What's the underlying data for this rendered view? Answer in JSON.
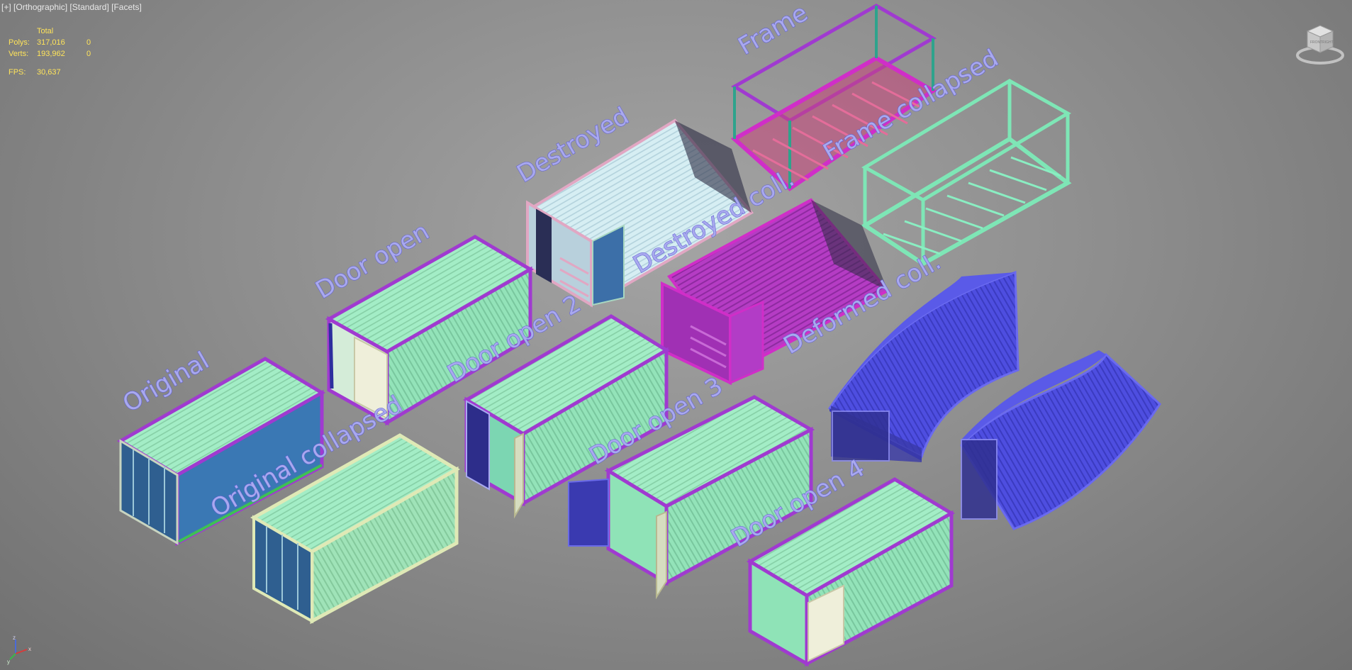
{
  "viewport": {
    "menu_plus": "[+]",
    "view_mode": "[Orthographic]",
    "shading_style": "[Standard]",
    "display_mode": "[Facets]"
  },
  "stats": {
    "header": "Total",
    "polys_label": "Polys:",
    "polys_total": "317,016",
    "polys_selected": "0",
    "verts_label": "Verts:",
    "verts_total": "193,962",
    "verts_selected": "0",
    "fps_label": "FPS:",
    "fps_value": "30,637"
  },
  "viewcube": {
    "icon": "viewcube-icon",
    "face_left": "FRONT",
    "face_right": "RIGHT"
  },
  "axis_gizmo": {
    "x": "x",
    "y": "y",
    "z": "z"
  },
  "scene_labels": {
    "frame": "Frame",
    "frame_collapsed": "Frame collapsed",
    "destroyed": "Destroyed",
    "destroyed_coll": "Destroyed coll.",
    "door_open": "Door open",
    "deformed_coll": "Deformed coll.",
    "original": "Original",
    "door_open_2": "Door open 2",
    "original_collapsed": "Original collapsed",
    "door_open_3": "Door open 3",
    "door_open_4": "Door open 4"
  },
  "colors": {
    "background": "#8e8e8e",
    "hud_text": "#ffe45a",
    "label_fill": "#a9a9ee",
    "label_outline": "#5e5ed3",
    "container_mint": "#93e3b9",
    "frame_purple": "#a03ad0",
    "frame_magenta": "#d02ec8",
    "door_blue": "#3c6fa8",
    "deformed_blue": "#4e4ee0",
    "frame_green": "#7ee6b6",
    "destroyed_white": "#d6eef3"
  }
}
